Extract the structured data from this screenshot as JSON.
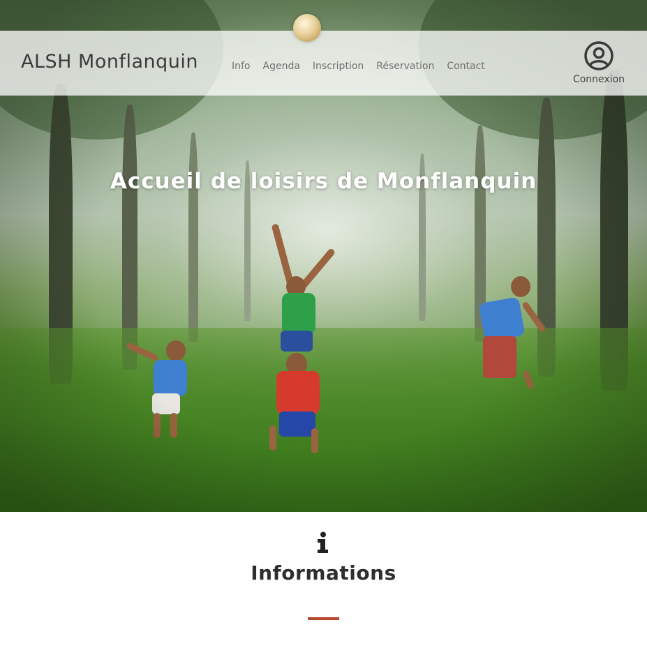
{
  "site": {
    "brand": "ALSH Monflanquin",
    "logo_icon": "ball-logo-icon"
  },
  "nav": {
    "items": [
      {
        "label": "Info"
      },
      {
        "label": "Agenda"
      },
      {
        "label": "Inscription"
      },
      {
        "label": "Réservation"
      },
      {
        "label": "Contact"
      }
    ],
    "login_label": "Connexion",
    "login_icon": "user-circle-icon"
  },
  "hero": {
    "title": "Accueil de loisirs de Monflanquin",
    "image": "children-playing-in-forest-photo"
  },
  "section": {
    "icon": "info-icon",
    "title": "Informations",
    "accent_color": "#b5482d"
  }
}
